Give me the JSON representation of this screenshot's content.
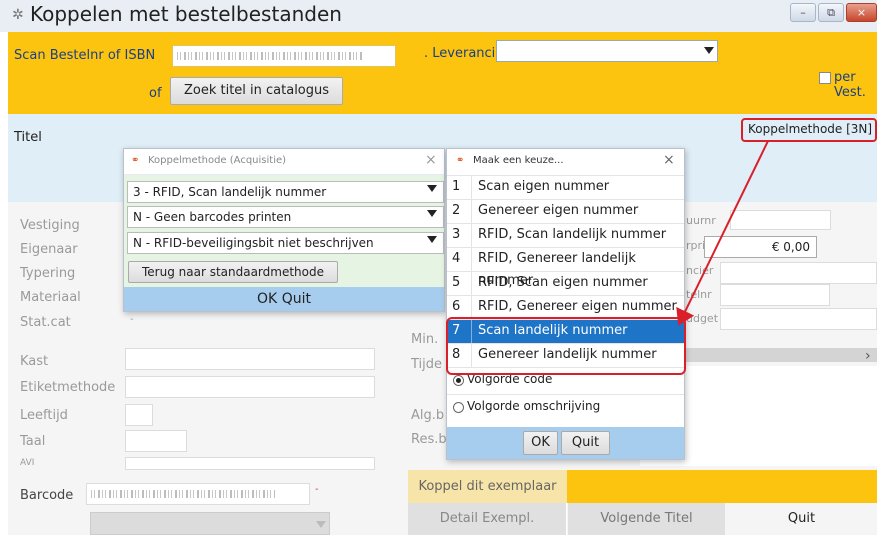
{
  "window": {
    "title": "Koppelen met bestelbestanden",
    "controls": [
      "–",
      "⧉",
      "×"
    ]
  },
  "top_panel": {
    "scan_label": "Scan Bestelnr of ISBN",
    "leverancier_label": ". Leverancier",
    "of_label": "of",
    "zoek_button": "Zoek titel in catalogus",
    "per_vest_label": "per Vest."
  },
  "titel_panel": {
    "titel_label": "Titel",
    "koppelmethode_button": "Koppelmethode [3N]"
  },
  "form": {
    "left_labels": [
      "Vestiging",
      "Eigenaar",
      "Typering",
      "Materiaal",
      "Stat.cat",
      "Kast",
      "Etiketmethode",
      "Leeftijd",
      "Taal",
      "AVI"
    ],
    "middle_labels": [
      "Min.",
      "Tijde",
      "Alg.b",
      "Res.b"
    ],
    "right_labels": [
      "uurnr",
      "rprijs",
      "ncier",
      "telnr",
      "udget"
    ],
    "price_value": "€ 0,00",
    "stat_cat_value": "-",
    "arrow_glyph": "›"
  },
  "bottom": {
    "barcode_label": "Barcode",
    "barcode_dot": "-",
    "koppel_button": "Koppel dit exemplaar",
    "detail_button": "Detail Exempl.",
    "volgende_button": "Volgende Titel",
    "quit_button": "Quit"
  },
  "dialog_koppelmethode": {
    "title": "Koppelmethode (Acquisitie)",
    "close": "×",
    "combo1": "3 - RFID, Scan landelijk nummer",
    "combo2": "N - Geen barcodes printen",
    "combo3": "N - RFID-beveiligingsbit niet beschrijven",
    "reset_button": "Terug naar standaardmethode",
    "ok_label": "OK",
    "quit_label": "Quit"
  },
  "dialog_keuze": {
    "title": "Maak een keuze...",
    "close": "×",
    "options": [
      {
        "num": "1",
        "label": "Scan eigen nummer"
      },
      {
        "num": "2",
        "label": "Genereer eigen nummer"
      },
      {
        "num": "3",
        "label": "RFID, Scan landelijk nummer"
      },
      {
        "num": "4",
        "label": "RFID, Genereer landelijk nummer"
      },
      {
        "num": "5",
        "label": "RFID, Scan eigen nummer"
      },
      {
        "num": "6",
        "label": "RFID, Genereer eigen nummer"
      },
      {
        "num": "7",
        "label": "Scan landelijk nummer"
      },
      {
        "num": "8",
        "label": "Genereer landelijk nummer"
      }
    ],
    "selected_index": 6,
    "radio_code": "Volgorde code",
    "radio_omschrijving": "Volgorde omschrijving",
    "ok_button": "OK",
    "quit_button": "Quit"
  },
  "colors": {
    "yellow": "#fcc40f",
    "highlight_blue": "#1e74c6",
    "annotation_red": "#d9202a",
    "dialog_green": "#e6f4e3",
    "footer_blue": "#a7cdee"
  }
}
